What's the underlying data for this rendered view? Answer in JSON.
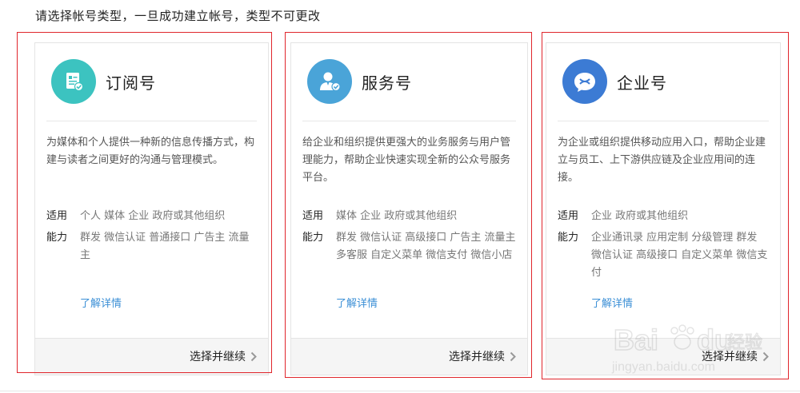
{
  "page": {
    "heading": "请选择帐号类型，一旦成功建立帐号，类型不可更改"
  },
  "labels": {
    "applies": "适用",
    "abilities": "能力",
    "learn_more": "了解详情",
    "continue": "选择并继续"
  },
  "cards": [
    {
      "title": "订阅号",
      "icon": "document-check-icon",
      "icon_color": "#3cc3c0",
      "description": "为媒体和个人提供一种新的信息传播方式，构建与读者之间更好的沟通与管理模式。",
      "applies_to": "个人 媒体 企业 政府或其他组织",
      "abilities": "群发 微信认证 普通接口 广告主 流量主"
    },
    {
      "title": "服务号",
      "icon": "user-check-icon",
      "icon_color": "#4aa4d8",
      "description": "给企业和组织提供更强大的业务服务与用户管理能力，帮助企业快速实现全新的公众号服务平台。",
      "applies_to": "媒体 企业 政府或其他组织",
      "abilities": "群发 微信认证 高级接口 广告主 流量主 多客服 自定义菜单 微信支付 微信小店"
    },
    {
      "title": "企业号",
      "icon": "chat-bubble-icon",
      "icon_color": "#3c7bd4",
      "description": "为企业或组织提供移动应用入口，帮助企业建立与员工、上下游供应链及企业应用间的连接。",
      "applies_to": "企业 政府或其他组织",
      "abilities": "企业通讯录 应用定制 分级管理 群发 微信认证 高级接口 自定义菜单 微信支付"
    }
  ],
  "watermark": {
    "brand": "Bai",
    "brand_suffix": "du",
    "cn": "经验",
    "url": "jingyan.baidu.com"
  },
  "colors": {
    "highlight_border": "#e0262c",
    "link": "#3b8fd6",
    "footer_bg": "#f5f5f5"
  }
}
